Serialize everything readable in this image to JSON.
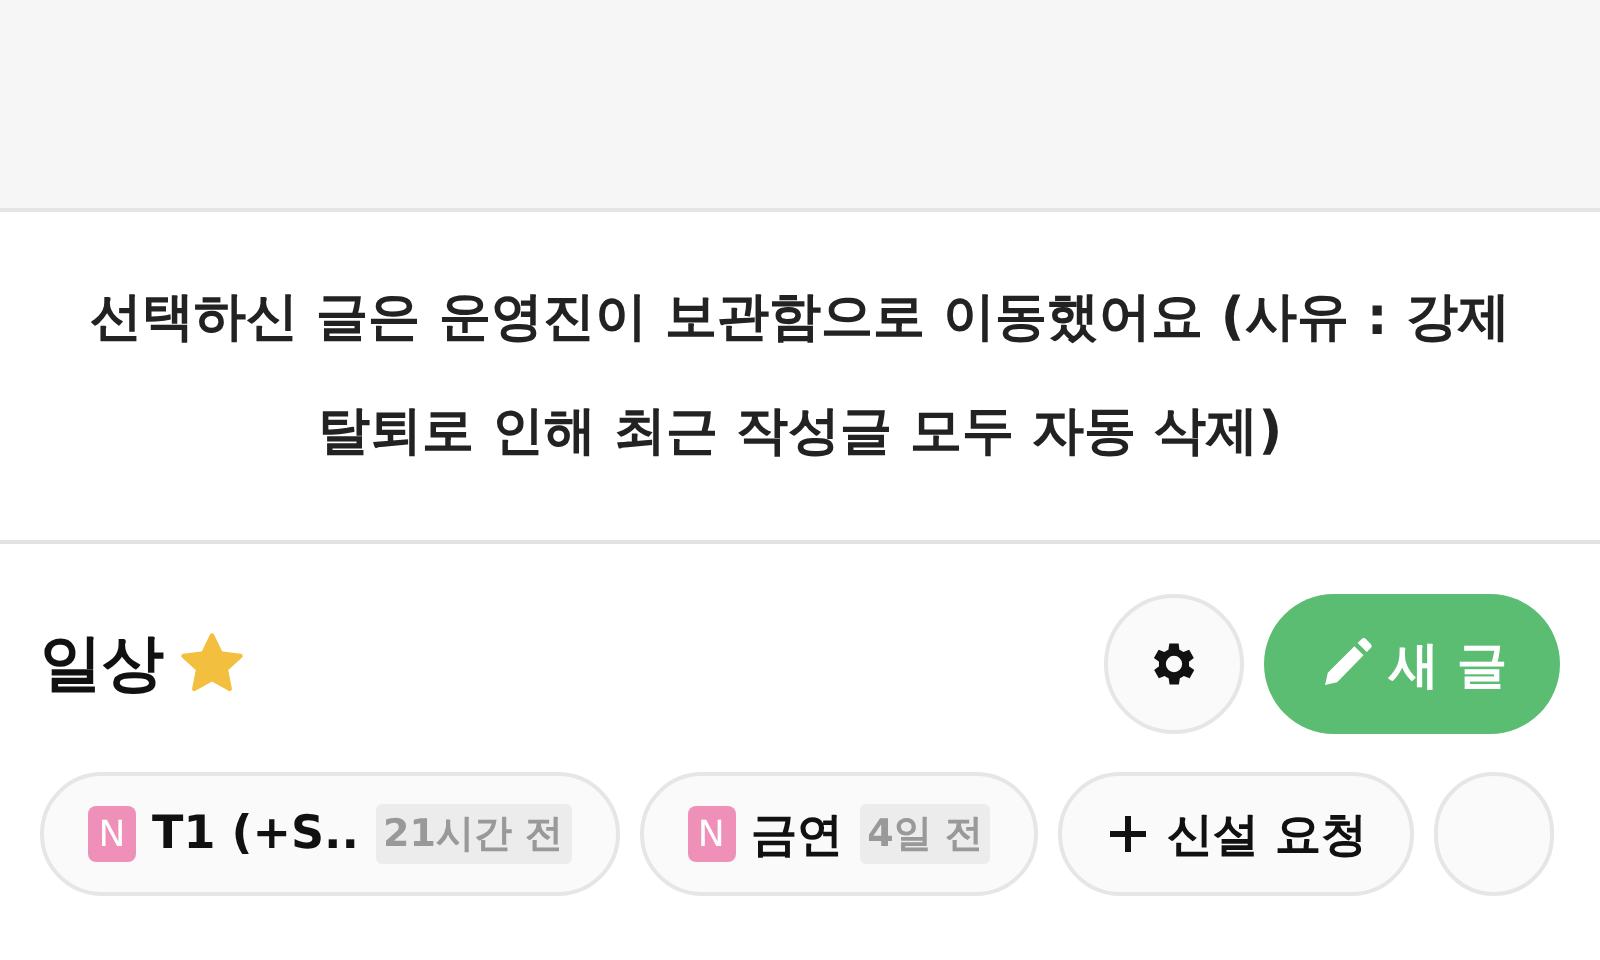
{
  "notice": {
    "text": "선택하신 글은 운영진이 보관함으로 이동했어요 (사유 : 강제 탈퇴로 인해 최근 작성글 모두 자동 삭제)"
  },
  "board": {
    "title": "일상",
    "favorite": true,
    "new_post_label": "새 글"
  },
  "chips": [
    {
      "kind": "post",
      "badge": "N",
      "label": "T1 (+S..",
      "time": "21시간 전"
    },
    {
      "kind": "post",
      "badge": "N",
      "label": "금연",
      "time": "4일 전"
    },
    {
      "kind": "add",
      "label": "신설 요청"
    },
    {
      "kind": "partial"
    }
  ]
}
